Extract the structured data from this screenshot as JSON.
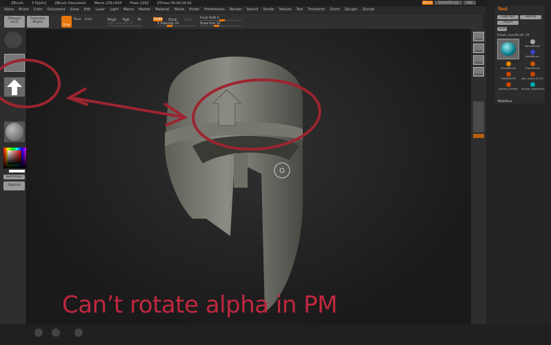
{
  "titlebar": {
    "app": "ZBrush",
    "version": "3.5[iptx]",
    "document": "ZBrush Document",
    "mem": "Mems 229+834",
    "free": "Frees 2282",
    "timer": "ZTimes 00:00:26.81"
  },
  "menus": [
    "Alpha",
    "Brush",
    "Color",
    "Document",
    "Draw",
    "Edit",
    "Layer",
    "Light",
    "Macro",
    "Marker",
    "Material",
    "Movie",
    "Picker",
    "Preferences",
    "Render",
    "Stencil",
    "Stroke",
    "Texture",
    "Tool",
    "Transform",
    "Zoom",
    "Zplugin",
    "Zscript"
  ],
  "topright": {
    "menus": "Menus",
    "script": "DefaultZScript",
    "help": "Help"
  },
  "toolbar": {
    "zmapper": "ZMapper rev-E",
    "projection": "Projection Master",
    "draw": "Draw",
    "move": "Move",
    "scale": "Scale",
    "mrgb": "Mrgb",
    "rgb": "Rgb",
    "m": "M",
    "rgb_intensity": "Rgb Intensity 75",
    "zadd": "Zadd",
    "zsub": "Zsub",
    "zcut": "Zcut",
    "z_intensity": "Z Intensity 33",
    "focal_shift": "Focal Shift 0",
    "draw_size": "Draw Size 32"
  },
  "left": {
    "switch_color": "SwitchColor",
    "zapplink": "ZAppLink"
  },
  "right_shelf": [
    "Scroll",
    "Zoom",
    "Actual",
    "AAHalf"
  ],
  "tool_panel": {
    "title": "Tool",
    "load": "Load Tool",
    "save": "Save As",
    "import": "Import",
    "clone": "Clone",
    "current": "Simple_LayerBrush. 18",
    "items": [
      "SphereBrush",
      "AlphaBrush",
      "SimpleBrush",
      "EraserBrush",
      "PolyMesh3D",
      "sphr_plane_PLC02",
      "spartan_helmet",
      "Simple_LayerBrush"
    ],
    "modifiers": "Modifiers"
  },
  "annotation": "Can’t rotate alpha in PM",
  "colors": {
    "accent": "#e8760c",
    "annotation": "#c0283f"
  }
}
